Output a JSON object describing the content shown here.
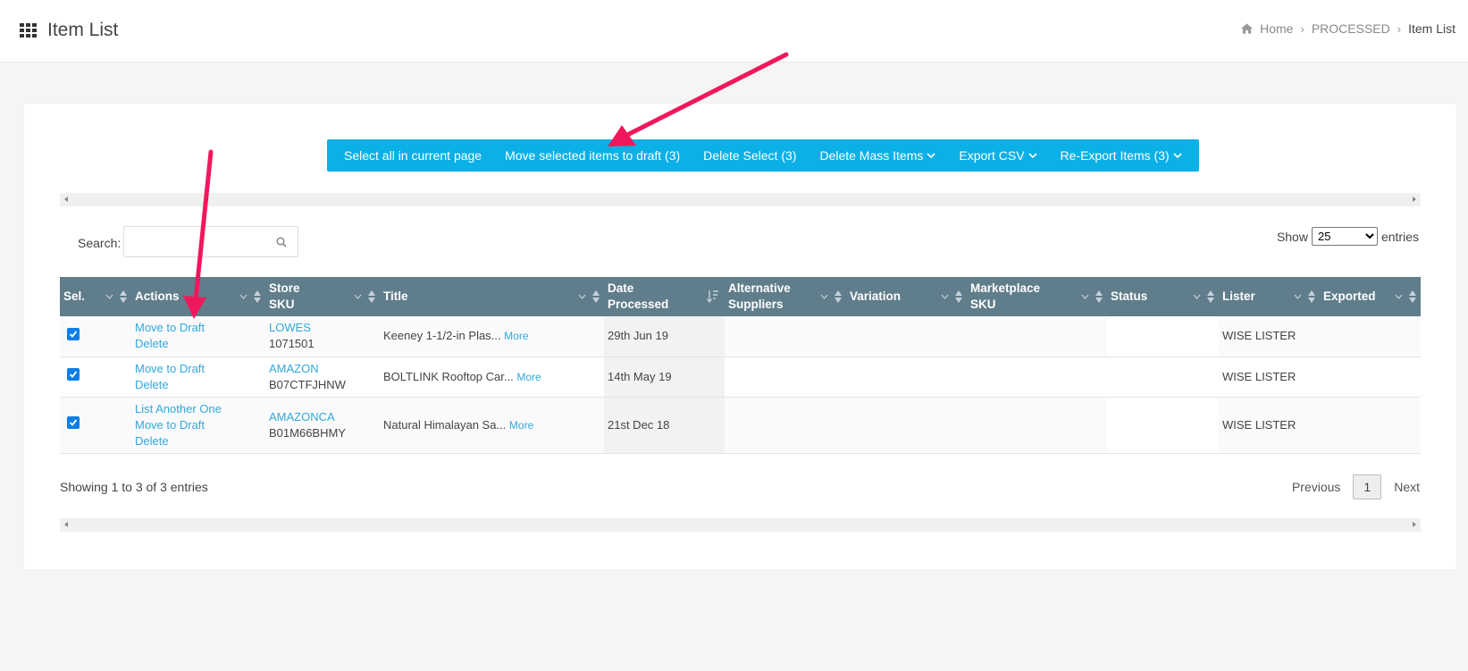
{
  "header": {
    "title": "Item List",
    "breadcrumb": [
      "Home",
      "PROCESSED",
      "Item List"
    ]
  },
  "toolbar": {
    "buttons": [
      {
        "label": "Select all in current page",
        "dropdown": false
      },
      {
        "label": "Move selected items to draft (3)",
        "dropdown": false
      },
      {
        "label": "Delete Select (3)",
        "dropdown": false
      },
      {
        "label": "Delete Mass Items",
        "dropdown": true
      },
      {
        "label": "Export CSV",
        "dropdown": true
      },
      {
        "label": "Re-Export Items (3)",
        "dropdown": true
      }
    ]
  },
  "search": {
    "label": "Search:",
    "value": "",
    "placeholder": ""
  },
  "length": {
    "show_label": "Show",
    "selected": "25",
    "entries_label": "entries"
  },
  "table": {
    "columns": [
      {
        "label": "Sel."
      },
      {
        "label": "Actions"
      },
      {
        "label": "Store\nSKU"
      },
      {
        "label": "Title"
      },
      {
        "label": "Date\nProcessed"
      },
      {
        "label": "Alternative\nSuppliers"
      },
      {
        "label": "Variation"
      },
      {
        "label": "Marketplace\nSKU"
      },
      {
        "label": "Status"
      },
      {
        "label": "Lister"
      },
      {
        "label": "Exported"
      }
    ],
    "rows": [
      {
        "checked": true,
        "actions": [
          "Move to Draft",
          "Delete"
        ],
        "store": "LOWES",
        "sku": "1071501",
        "title": "Keeney 1-1/2-in Plas...",
        "more": "More",
        "date": "29th Jun 19",
        "alt_suppliers": "",
        "variation": "",
        "marketplace_sku": "",
        "status": "",
        "lister": "WISE LISTER",
        "exported": ""
      },
      {
        "checked": true,
        "actions": [
          "Move to Draft",
          "Delete"
        ],
        "store": "AMAZON",
        "sku": "B07CTFJHNW",
        "title": "BOLTLINK Rooftop Car...",
        "more": "More",
        "date": "14th May 19",
        "alt_suppliers": "",
        "variation": "",
        "marketplace_sku": "",
        "status": "",
        "lister": "WISE LISTER",
        "exported": ""
      },
      {
        "checked": true,
        "actions": [
          "List Another One",
          "Move to Draft",
          "Delete"
        ],
        "store": "AMAZONCA",
        "sku": "B01M66BHMY",
        "title": "Natural Himalayan Sa...",
        "more": "More",
        "date": "21st Dec 18",
        "alt_suppliers": "",
        "variation": "",
        "marketplace_sku": "",
        "status": "",
        "lister": "WISE LISTER",
        "exported": ""
      }
    ]
  },
  "footer": {
    "info": "Showing 1 to 3 of 3 entries",
    "previous": "Previous",
    "current_page": "1",
    "next": "Next"
  },
  "colors": {
    "accent": "#0bb0e6",
    "header_bg": "#607d8b",
    "link": "#2fa9dc",
    "annotation_arrow": "#f0185c"
  }
}
